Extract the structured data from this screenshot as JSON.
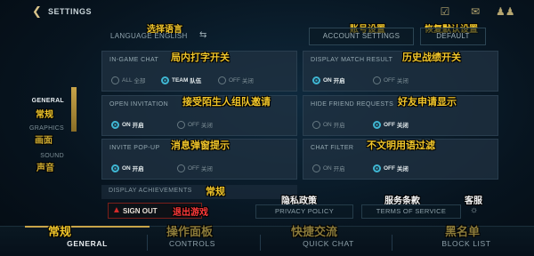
{
  "header": {
    "title": "SETTINGS",
    "back_icon": "back-chevron-icon",
    "icons": [
      "checkbox-icon",
      "chat-icon",
      "friends-icon"
    ]
  },
  "language": {
    "label": "LANGUAGE ENGLISH"
  },
  "buttons": {
    "account": "ACCOUNT SETTINGS",
    "default": "DEFAULT"
  },
  "sidebar": {
    "items": [
      {
        "label": "GENERAL",
        "note": "常规"
      },
      {
        "label": "GRAPHICS",
        "note": "画面"
      },
      {
        "label": "SOUND",
        "note": "声音"
      }
    ]
  },
  "settings": {
    "in_game_chat": {
      "label": "IN-GAME CHAT",
      "note": "局内打字开关",
      "options": [
        {
          "en": "ALL",
          "zh": "全部"
        },
        {
          "en": "TEAM",
          "zh": "队伍"
        },
        {
          "en": "OFF",
          "zh": "关闭"
        }
      ],
      "selected": 1
    },
    "display_match": {
      "label": "DISPLAY MATCH RESULT",
      "note": "历史战绩开关",
      "options": [
        {
          "en": "ON",
          "zh": "开启"
        },
        {
          "en": "OFF",
          "zh": "关闭"
        }
      ],
      "selected": 0
    },
    "open_invitation": {
      "label": "OPEN INVITATION",
      "note": "接受陌生人组队邀请",
      "options": [
        {
          "en": "ON",
          "zh": "开启"
        },
        {
          "en": "OFF",
          "zh": "关闭"
        }
      ],
      "selected": 0
    },
    "hide_friend": {
      "label": "HIDE FRIEND REQUESTS",
      "note": "好友申请显示",
      "options": [
        {
          "en": "ON",
          "zh": "开启"
        },
        {
          "en": "OFF",
          "zh": "关闭"
        }
      ],
      "selected": 1
    },
    "invite_popup": {
      "label": "INVITE POP-UP",
      "note": "消息弹窗提示",
      "options": [
        {
          "en": "ON",
          "zh": "开启"
        },
        {
          "en": "OFF",
          "zh": "关闭"
        }
      ],
      "selected": 0
    },
    "chat_filter": {
      "label": "CHAT FILTER",
      "note": "不文明用语过滤",
      "options": [
        {
          "en": "ON",
          "zh": "开启"
        },
        {
          "en": "OFF",
          "zh": "关闭"
        }
      ],
      "selected": 1
    },
    "display_achievements": {
      "label": "DISPLAY ACHIEVEMENTS",
      "note": "常规"
    }
  },
  "footer": {
    "signout": "SIGN OUT",
    "signout_note": "退出游戏",
    "privacy": "PRIVACY POLICY",
    "privacy_note": "隐私政策",
    "terms": "TERMS OF SERVICE",
    "terms_note": "服务条款",
    "support_note": "客服"
  },
  "notes": {
    "language": "选择语言",
    "account": "账号设置",
    "default": "恢复默认设置"
  },
  "tabs": [
    {
      "label": "GENERAL",
      "note": "常规"
    },
    {
      "label": "CONTROLS",
      "note": "操作面板"
    },
    {
      "label": "QUICK CHAT",
      "note": "快捷交流"
    },
    {
      "label": "BLOCK LIST",
      "note": "黑名单"
    }
  ],
  "colors": {
    "accent": "#3fb7d3",
    "gold": "#c8a449",
    "annotation": "#f0c52a",
    "danger": "#d52a2a"
  }
}
